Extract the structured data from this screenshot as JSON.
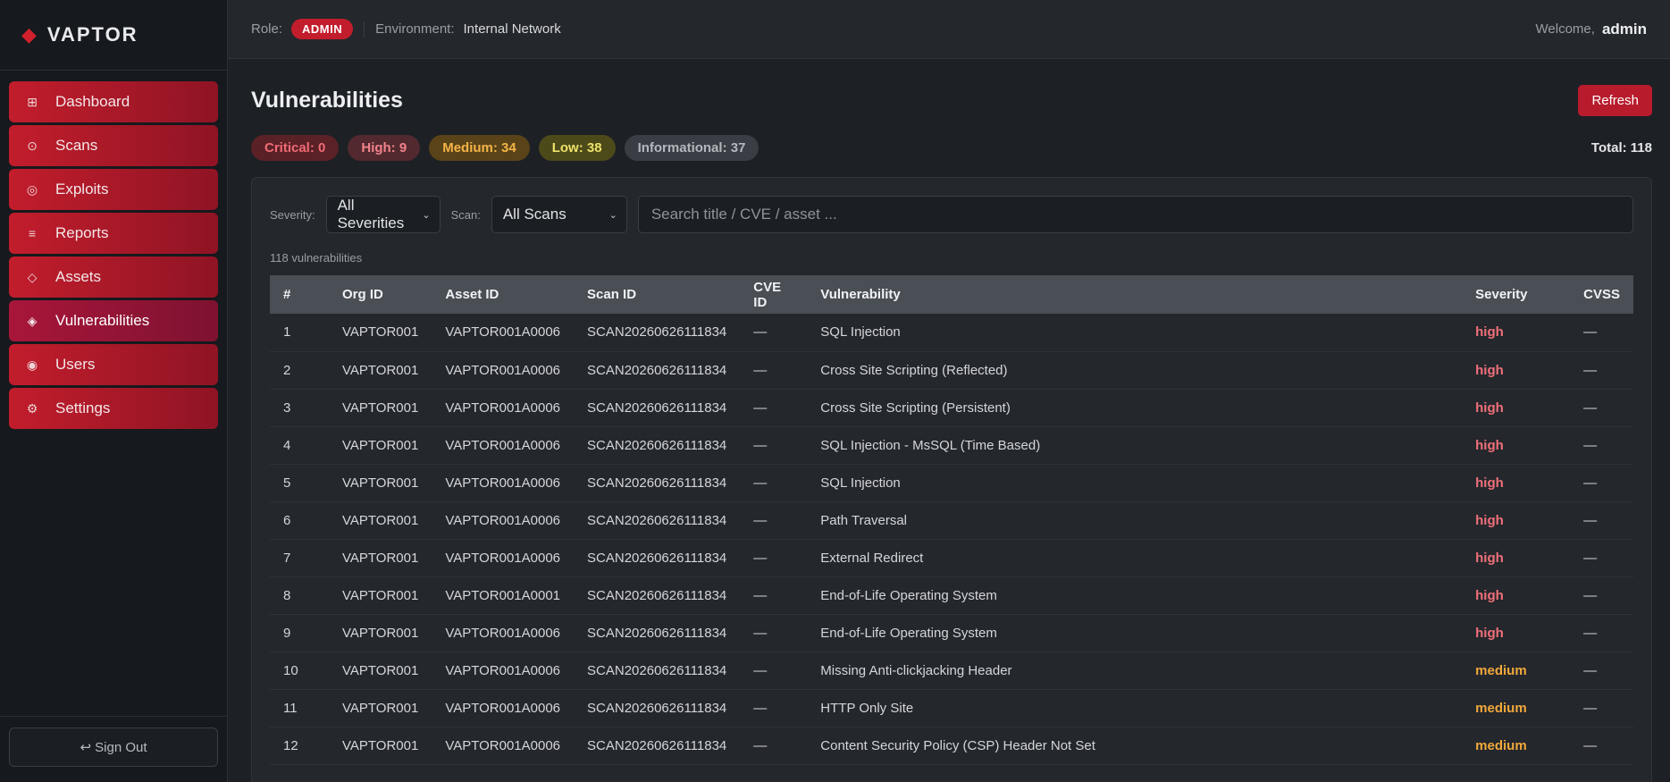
{
  "brand": {
    "name": "VAPTOR",
    "icon": "diamond-icon"
  },
  "sidebar": {
    "items": [
      {
        "label": "Dashboard",
        "icon": "⊞",
        "active": false
      },
      {
        "label": "Scans",
        "icon": "⊙",
        "active": false
      },
      {
        "label": "Exploits",
        "icon": "◎",
        "active": false
      },
      {
        "label": "Reports",
        "icon": "≡",
        "active": false
      },
      {
        "label": "Assets",
        "icon": "◇",
        "active": false
      },
      {
        "label": "Vulnerabilities",
        "icon": "◈",
        "active": true
      },
      {
        "label": "Users",
        "icon": "◉",
        "active": false
      },
      {
        "label": "Settings",
        "icon": "⚙",
        "active": false
      }
    ],
    "signout_label": "↩ Sign Out"
  },
  "topbar": {
    "role_label": "Role:",
    "role_value": "ADMIN",
    "env_label": "Environment:",
    "env_value": "Internal Network",
    "welcome_label": "Welcome,",
    "user": "admin"
  },
  "page": {
    "title": "Vulnerabilities",
    "refresh_label": "Refresh",
    "total_label": "Total: 118",
    "summary": {
      "critical": "Critical: 0",
      "high": "High: 9",
      "medium": "Medium: 34",
      "low": "Low: 38",
      "info": "Informational: 37"
    }
  },
  "filters": {
    "severity_label": "Severity:",
    "severity_value": "All Severities",
    "scan_label": "Scan:",
    "scan_value": "All Scans",
    "search_placeholder": "Search title / CVE / asset ..."
  },
  "table": {
    "count_text": "118 vulnerabilities",
    "headers": [
      "#",
      "Org ID",
      "Asset ID",
      "Scan ID",
      "CVE ID",
      "Vulnerability",
      "Severity",
      "CVSS"
    ],
    "rows": [
      [
        "1",
        "VAPTOR001",
        "VAPTOR001A0006",
        "SCAN20260626111834",
        "—",
        "SQL Injection",
        "high",
        "—"
      ],
      [
        "2",
        "VAPTOR001",
        "VAPTOR001A0006",
        "SCAN20260626111834",
        "—",
        "Cross Site Scripting (Reflected)",
        "high",
        "—"
      ],
      [
        "3",
        "VAPTOR001",
        "VAPTOR001A0006",
        "SCAN20260626111834",
        "—",
        "Cross Site Scripting (Persistent)",
        "high",
        "—"
      ],
      [
        "4",
        "VAPTOR001",
        "VAPTOR001A0006",
        "SCAN20260626111834",
        "—",
        "SQL Injection - MsSQL (Time Based)",
        "high",
        "—"
      ],
      [
        "5",
        "VAPTOR001",
        "VAPTOR001A0006",
        "SCAN20260626111834",
        "—",
        "SQL Injection",
        "high",
        "—"
      ],
      [
        "6",
        "VAPTOR001",
        "VAPTOR001A0006",
        "SCAN20260626111834",
        "—",
        "Path Traversal",
        "high",
        "—"
      ],
      [
        "7",
        "VAPTOR001",
        "VAPTOR001A0006",
        "SCAN20260626111834",
        "—",
        "External Redirect",
        "high",
        "—"
      ],
      [
        "8",
        "VAPTOR001",
        "VAPTOR001A0001",
        "SCAN20260626111834",
        "—",
        "End-of-Life Operating System",
        "high",
        "—"
      ],
      [
        "9",
        "VAPTOR001",
        "VAPTOR001A0006",
        "SCAN20260626111834",
        "—",
        "End-of-Life Operating System",
        "high",
        "—"
      ],
      [
        "10",
        "VAPTOR001",
        "VAPTOR001A0006",
        "SCAN20260626111834",
        "—",
        "Missing Anti-clickjacking Header",
        "medium",
        "—"
      ],
      [
        "11",
        "VAPTOR001",
        "VAPTOR001A0006",
        "SCAN20260626111834",
        "—",
        "HTTP Only Site",
        "medium",
        "—"
      ],
      [
        "12",
        "VAPTOR001",
        "VAPTOR001A0006",
        "SCAN20260626111834",
        "—",
        "Content Security Policy (CSP) Header Not Set",
        "medium",
        "—"
      ]
    ]
  },
  "colors": {
    "accent": "#c21d2c",
    "high": "#f0707a",
    "medium": "#f2a93c"
  }
}
